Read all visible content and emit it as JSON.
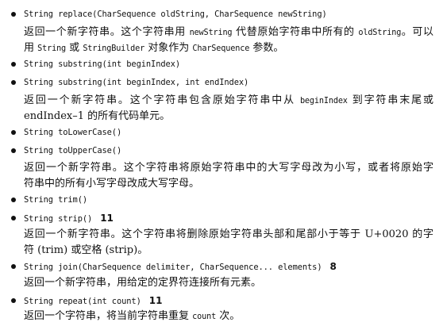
{
  "entries": [
    {
      "signature": "String replace(CharSequence oldString, CharSequence newString)",
      "version": "",
      "desc1": {
        "a": "返回一个新字符串。这个字符串用 ",
        "c1": "newString",
        "b": " 代替原始字符串中所有的 ",
        "c2": "oldString",
        "d": "。可以"
      },
      "desc2": {
        "a": "用 ",
        "c1": "String",
        "b": " 或 ",
        "c2": "StringBuilder",
        "c": " 对象作为 ",
        "c3": "CharSequence",
        "d": " 参数。"
      }
    },
    {
      "signature": "String substring(int beginIndex)",
      "version": ""
    },
    {
      "signature": "String substring(int beginIndex, int endIndex)",
      "version": "",
      "desc1": {
        "a": "返回一个新字符串。这个字符串包含原始字符串中从 ",
        "c1": "beginIndex",
        "b": " 到字符串末尾或"
      },
      "desc2": {
        "a": "endIndex–1 的所有代码单元。"
      }
    },
    {
      "signature": "String toLowerCase()",
      "version": ""
    },
    {
      "signature": "String toUpperCase()",
      "version": "",
      "desc1": {
        "a": "返回一个新字符串。这个字符串将原始字符串中的大写字母改为小写，或者将原始字"
      },
      "desc2": {
        "a": "符串中的所有小写字母改成大写字母。"
      }
    },
    {
      "signature": "String trim()",
      "version": ""
    },
    {
      "signature": "String strip()",
      "version": "11",
      "desc1": {
        "a": "返回一个新字符串。这个字符串将删除原始字符串头部和尾部小于等于 U+0020 的字"
      },
      "desc2": {
        "a": "符 (trim) 或空格 (strip)。"
      }
    },
    {
      "signature": "String join(CharSequence delimiter, CharSequence... elements)",
      "version": "8",
      "desc1": {
        "a": "返回一个新字符串，用给定的定界符连接所有元素。"
      }
    },
    {
      "signature": "String repeat(int count)",
      "version": "11",
      "desc1": {
        "a": "返回一个字符串，将当前字符串重复 ",
        "c1": "count",
        "b": " 次。"
      }
    }
  ]
}
